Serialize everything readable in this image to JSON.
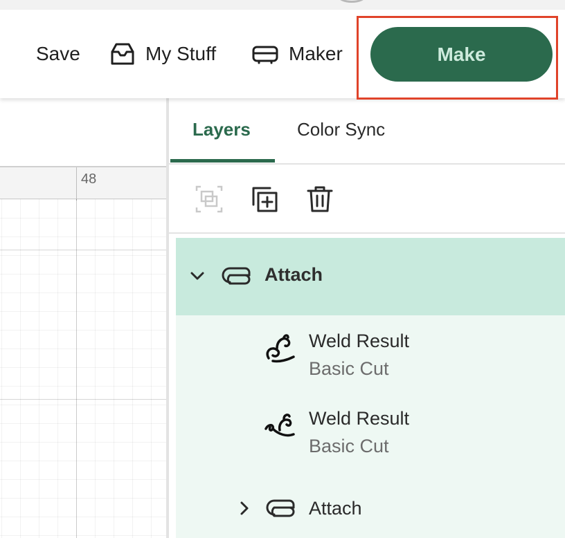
{
  "toolbar": {
    "save_label": "Save",
    "my_stuff_label": "My Stuff",
    "maker_label": "Maker",
    "make_label": "Make"
  },
  "canvas": {
    "ruler_label": "48"
  },
  "panel": {
    "tabs": [
      {
        "label": "Layers",
        "active": true
      },
      {
        "label": "Color Sync",
        "active": false
      }
    ],
    "tools": [
      "group-icon",
      "duplicate-icon",
      "delete-icon"
    ],
    "layers": {
      "group": {
        "label": "Attach",
        "expanded": true
      },
      "items": [
        {
          "name": "Weld Result",
          "operation": "Basic Cut"
        },
        {
          "name": "Weld Result",
          "operation": "Basic Cut"
        }
      ],
      "sub_group": {
        "label": "Attach",
        "expanded": false
      }
    }
  },
  "colors": {
    "accent": "#2b6a4d",
    "make_text": "#cdebdd",
    "highlight_border": "#e0432a",
    "selected_group_bg": "#c8eadd",
    "group_items_bg": "#eef8f3"
  }
}
